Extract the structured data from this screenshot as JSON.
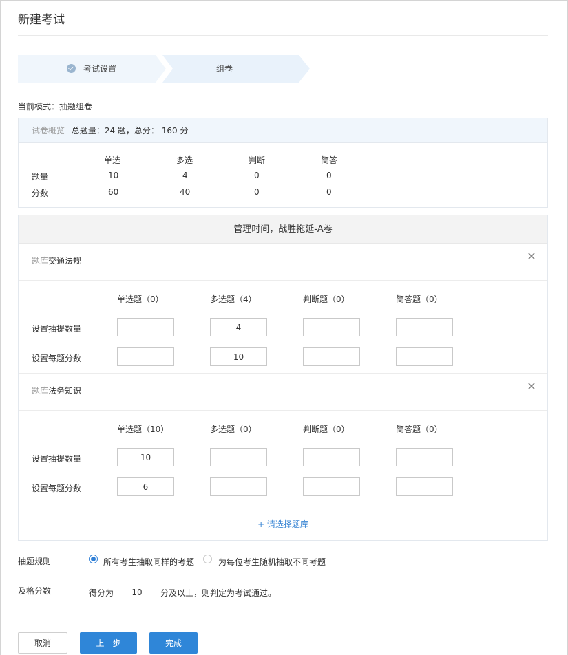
{
  "page": {
    "title": "新建考试"
  },
  "steps": [
    {
      "label": "考试设置",
      "done": true
    },
    {
      "label": "组卷",
      "done": false
    }
  ],
  "mode": {
    "label": "当前模式：",
    "value": "抽题组卷"
  },
  "overview": {
    "label": "试卷概览",
    "summary": "总题量：24 题，总分： 160 分",
    "columns": [
      "单选",
      "多选",
      "判断",
      "简答"
    ],
    "rows": [
      {
        "label": "题量",
        "values": [
          "10",
          "4",
          "0",
          "0"
        ]
      },
      {
        "label": "分数",
        "values": [
          "60",
          "40",
          "0",
          "0"
        ]
      }
    ]
  },
  "paper": {
    "title": "管理时间，战胜拖延-A卷",
    "banks": [
      {
        "prefix": "题库",
        "name": "交通法规",
        "columns": [
          "单选题（0）",
          "多选题（4）",
          "判断题（0）",
          "简答题（0）"
        ],
        "count_label": "设置抽提数量",
        "score_label": "设置每题分数",
        "counts": [
          "",
          "4",
          "",
          ""
        ],
        "scores": [
          "",
          "10",
          "",
          ""
        ]
      },
      {
        "prefix": "题库",
        "name": "法务知识",
        "columns": [
          "单选题（10）",
          "多选题（0）",
          "判断题（0）",
          "简答题（0）"
        ],
        "count_label": "设置抽提数量",
        "score_label": "设置每题分数",
        "counts": [
          "10",
          "",
          "",
          ""
        ],
        "scores": [
          "6",
          "",
          "",
          ""
        ]
      }
    ],
    "add_bank": "+ 请选择题库"
  },
  "rules": {
    "label": "抽题规则",
    "options": [
      {
        "label": "所有考生抽取同样的考题",
        "selected": true
      },
      {
        "label": "为每位考生随机抽取不同考题",
        "selected": false
      }
    ]
  },
  "pass": {
    "label": "及格分数",
    "prefix": "得分为",
    "value": "10",
    "suffix": "分及以上，则判定为考试通过。"
  },
  "buttons": {
    "cancel": "取消",
    "prev": "上一步",
    "done": "完成"
  },
  "colors": {
    "primary": "#2f86d8",
    "step_bg": "#e9f2fb",
    "link": "#3a86d4"
  }
}
